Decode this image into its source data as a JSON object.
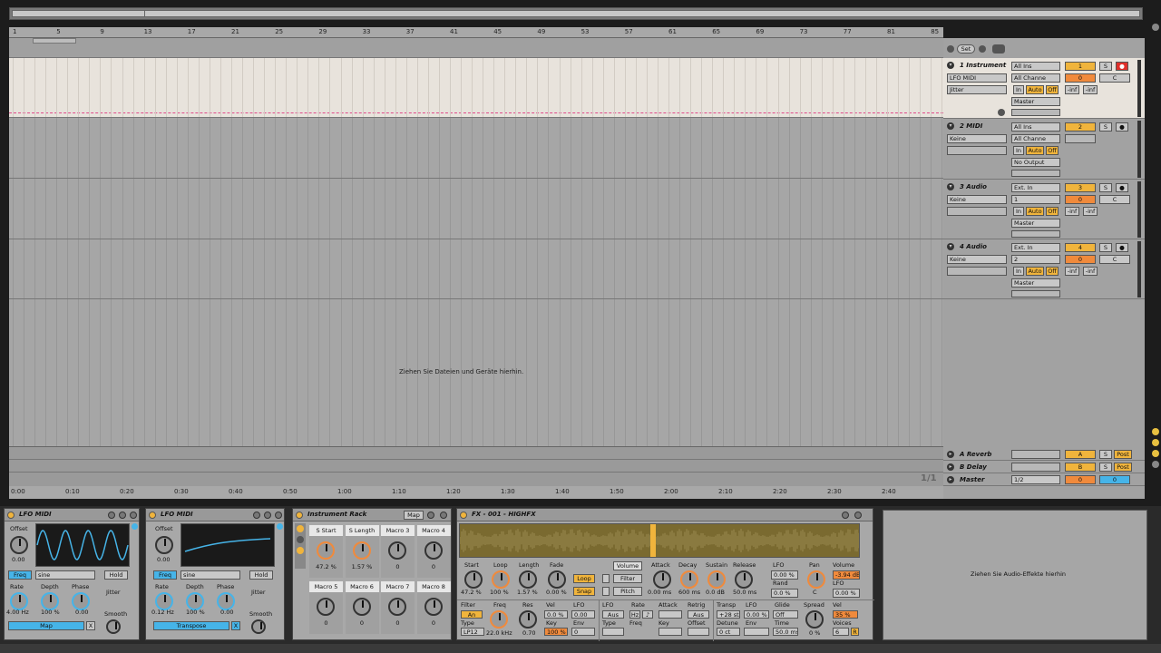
{
  "ruler": {
    "bars": [
      "1",
      "5",
      "9",
      "13",
      "17",
      "21",
      "25",
      "29",
      "33",
      "37",
      "41",
      "45",
      "49",
      "53",
      "57",
      "61",
      "65",
      "69",
      "73",
      "77",
      "81",
      "85"
    ]
  },
  "timeline": {
    "times": [
      "0:00",
      "0:10",
      "0:20",
      "0:30",
      "0:40",
      "0:50",
      "1:00",
      "1:10",
      "1:20",
      "1:30",
      "1:40",
      "1:50",
      "2:00",
      "2:10",
      "2:20",
      "2:30",
      "2:40"
    ]
  },
  "arrangement": {
    "drop_message": "Ziehen Sie Dateien und Geräte hierhin.",
    "page_counter": "1/1"
  },
  "mixer": {
    "set_label": "Set",
    "tracks": [
      {
        "name": "1 Instrument",
        "device": "LFO MIDI",
        "chain": "Jitter",
        "input": "All Ins",
        "channel": "All Channe",
        "output": "Master",
        "number": "1",
        "vol": "0",
        "pan": "C",
        "in_label": "In",
        "auto_label": "Auto",
        "off_label": "Off",
        "inf1": "-inf",
        "inf2": "-inf",
        "s_label": "S",
        "arm_color": "#e0302a"
      },
      {
        "name": "2 MIDI",
        "device": "Keine",
        "input": "All Ins",
        "channel": "All Channe",
        "output": "No Output",
        "number": "2",
        "in_label": "In",
        "auto_label": "Auto",
        "off_label": "Off",
        "s_label": "S"
      },
      {
        "name": "3 Audio",
        "device": "Keine",
        "input": "Ext. In",
        "channel": "1",
        "output": "Master",
        "number": "3",
        "vol": "0",
        "pan": "C",
        "in_label": "In",
        "auto_label": "Auto",
        "off_label": "Off",
        "inf1": "-inf",
        "inf2": "-inf",
        "s_label": "S"
      },
      {
        "name": "4 Audio",
        "device": "Keine",
        "input": "Ext. In",
        "channel": "2",
        "output": "Master",
        "number": "4",
        "vol": "0",
        "pan": "C",
        "in_label": "In",
        "auto_label": "Auto",
        "off_label": "Off",
        "inf1": "-inf",
        "inf2": "-inf",
        "s_label": "S"
      }
    ],
    "returns": [
      {
        "name": "A Reverb",
        "letter": "A",
        "s_label": "S",
        "post": "Post"
      },
      {
        "name": "B Delay",
        "letter": "B",
        "s_label": "S",
        "post": "Post"
      }
    ],
    "master": {
      "name": "Master",
      "cue": "1/2",
      "vol": "0",
      "pan": "0"
    }
  },
  "lfo1": {
    "title": "LFO MIDI",
    "offset_label": "Offset",
    "offset_val": "0.00",
    "freq_btn": "Freq",
    "shape": "sine",
    "hold": "Hold",
    "rate_label": "Rate",
    "depth_label": "Depth",
    "phase_label": "Phase",
    "rate_val": "4.00 Hz",
    "depth_val": "100 %",
    "phase_val": "0.00",
    "jitter_label": "Jitter",
    "smooth_label": "Smooth",
    "map_btn": "Map",
    "x_btn": "X"
  },
  "lfo2": {
    "title": "LFO MIDI",
    "offset_label": "Offset",
    "offset_val": "0.00",
    "freq_btn": "Freq",
    "shape": "sine",
    "hold": "Hold",
    "rate_label": "Rate",
    "depth_label": "Depth",
    "phase_label": "Phase",
    "rate_val": "0.12 Hz",
    "depth_val": "100 %",
    "phase_val": "0.00",
    "jitter_label": "Jitter",
    "smooth_label": "Smooth",
    "map_btn": "Transpose",
    "x_btn": "X"
  },
  "rack": {
    "title": "Instrument Rack",
    "map_btn": "Map",
    "macros": [
      {
        "name": "S Start",
        "val": "47.2 %"
      },
      {
        "name": "S Length",
        "val": "1.57 %"
      },
      {
        "name": "Macro 3",
        "val": "0"
      },
      {
        "name": "Macro 4",
        "val": "0"
      },
      {
        "name": "Macro 5",
        "val": "0"
      },
      {
        "name": "Macro 6",
        "val": "0"
      },
      {
        "name": "Macro 7",
        "val": "0"
      },
      {
        "name": "Macro 8",
        "val": "0"
      }
    ]
  },
  "sampler": {
    "title": "FX - 001 - HIGHFX",
    "start_label": "Start",
    "loop_label": "Loop",
    "length_label": "Length",
    "fade_label": "Fade",
    "start_val": "47.2 %",
    "loop_val": "100 %",
    "length_val": "1.57 %",
    "fade_val": "0.00 %",
    "loop_btn": "Loop",
    "snap_btn": "Snap",
    "volume_tab": "Volume",
    "filter_tab": "Filter",
    "pitch_tab": "Pitch",
    "attack_label": "Attack",
    "decay_label": "Decay",
    "sustain_label": "Sustain",
    "release_label": "Release",
    "attack_val": "0.00 ms",
    "decay_val": "600 ms",
    "sustain_val": "0.0 dB",
    "release_val": "50.0 ms",
    "lfo_label": "LFO",
    "lfo_val": "0.00 %",
    "rand_label": "Rand",
    "rand_val": "0.0 %",
    "pan_label": "Pan",
    "pan_val": "C",
    "volume_label": "Volume",
    "volume_val": "-3.94 dB",
    "lfo2_label": "LFO",
    "lfo2_val": "0.00 %",
    "filter_label": "Filter",
    "an_btn": "An",
    "type_label": "Type",
    "type_val": "LP12",
    "freq_label": "Freq",
    "freq_val": "22.0 kHz",
    "res_label": "Res",
    "res_val": "0.70",
    "vel_label": "Vel",
    "vel_val": "0.0 %",
    "key_label": "Key",
    "key_val": "100 %",
    "lfo3_label": "LFO",
    "lfo3_val": "0.00",
    "env_label": "Env",
    "env_val": "0",
    "lfo4_label": "LFO",
    "aus_btn": "Aus",
    "rate_label": "Rate",
    "hz_btn": "Hz",
    "note_btn": "♪",
    "attack2_label": "Attack",
    "retrig_label": "Retrig",
    "aus2_btn": "Aus",
    "type2_label": "Type",
    "freq2_label": "Freq",
    "key2_label": "Key",
    "offset_label": "Offset",
    "transp_label": "Transp",
    "transp_val": "+28 st",
    "detune_label": "Detune",
    "detune_val": "0 ct",
    "lfo5_label": "LFO",
    "lfo5_val": "0.00 %",
    "env2_label": "Env",
    "glide_label": "Glide",
    "glide_val": "Off",
    "time_label": "Time",
    "time_val": "50.0 ms",
    "spread_label": "Spread",
    "spread_val": "0 %",
    "vel2_label": "Vel",
    "vel2_val": "35 %",
    "voices_label": "Voices",
    "voices_val": "6",
    "r_btn": "R"
  },
  "audio_drop": "Ziehen Sie Audio-Effekte hierhin"
}
